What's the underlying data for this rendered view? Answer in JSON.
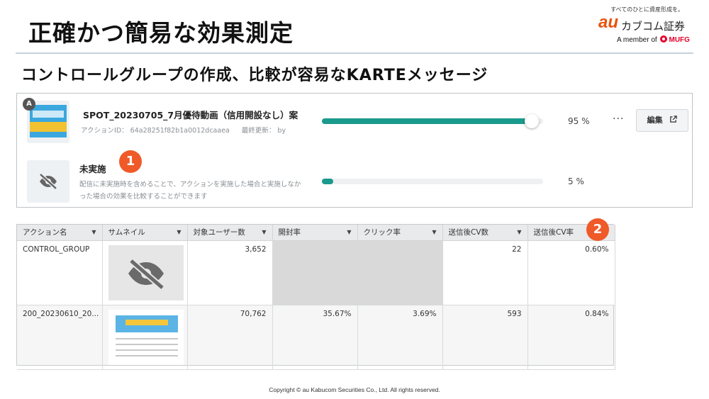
{
  "header": {
    "title": "正確かつ簡易な効果測定",
    "subtitle": "コントロールグループの作成、比較が容易なKARTEメッセージ"
  },
  "logo": {
    "tagline": "すべてのひとに資産形成を。",
    "au": "au",
    "brand": "カブコム証券",
    "member_prefix": "A member of",
    "mufg": "MUFG"
  },
  "panel": {
    "variant_badge": "A",
    "action": {
      "name": "SPOT_20230705_7月優待動画（信用開設なし）案",
      "id_text": "アクションID： 64a28251f82b1a0012dcaaea",
      "updated_text": "最終更新： by",
      "percent": "95  %",
      "percent_value": 95,
      "more_label": "···",
      "edit_label": "編集"
    },
    "control": {
      "name": "未実施",
      "description": "配信に未実施時を含めることで、アクションを実施した場合と実施しなかった場合の効果を比較することができます",
      "percent": "5  %",
      "percent_value": 5
    },
    "callout": "1"
  },
  "table": {
    "callout": "2",
    "columns": [
      "アクション名",
      "サムネイル",
      "対象ユーザー数",
      "開封率",
      "クリック率",
      "送信後CV数",
      "送信後CV率"
    ],
    "rows": [
      {
        "name": "CONTROL_GROUP",
        "users": "3,652",
        "open": "",
        "click": "",
        "cv": "22",
        "cv_rate": "0.60%"
      },
      {
        "name": "200_20230610_20...",
        "users": "70,762",
        "open": "35.67%",
        "click": "3.69%",
        "cv": "593",
        "cv_rate": "0.84%"
      }
    ]
  },
  "footer": "Copyright © au Kabucom Securities Co., Ltd. All rights reserved."
}
